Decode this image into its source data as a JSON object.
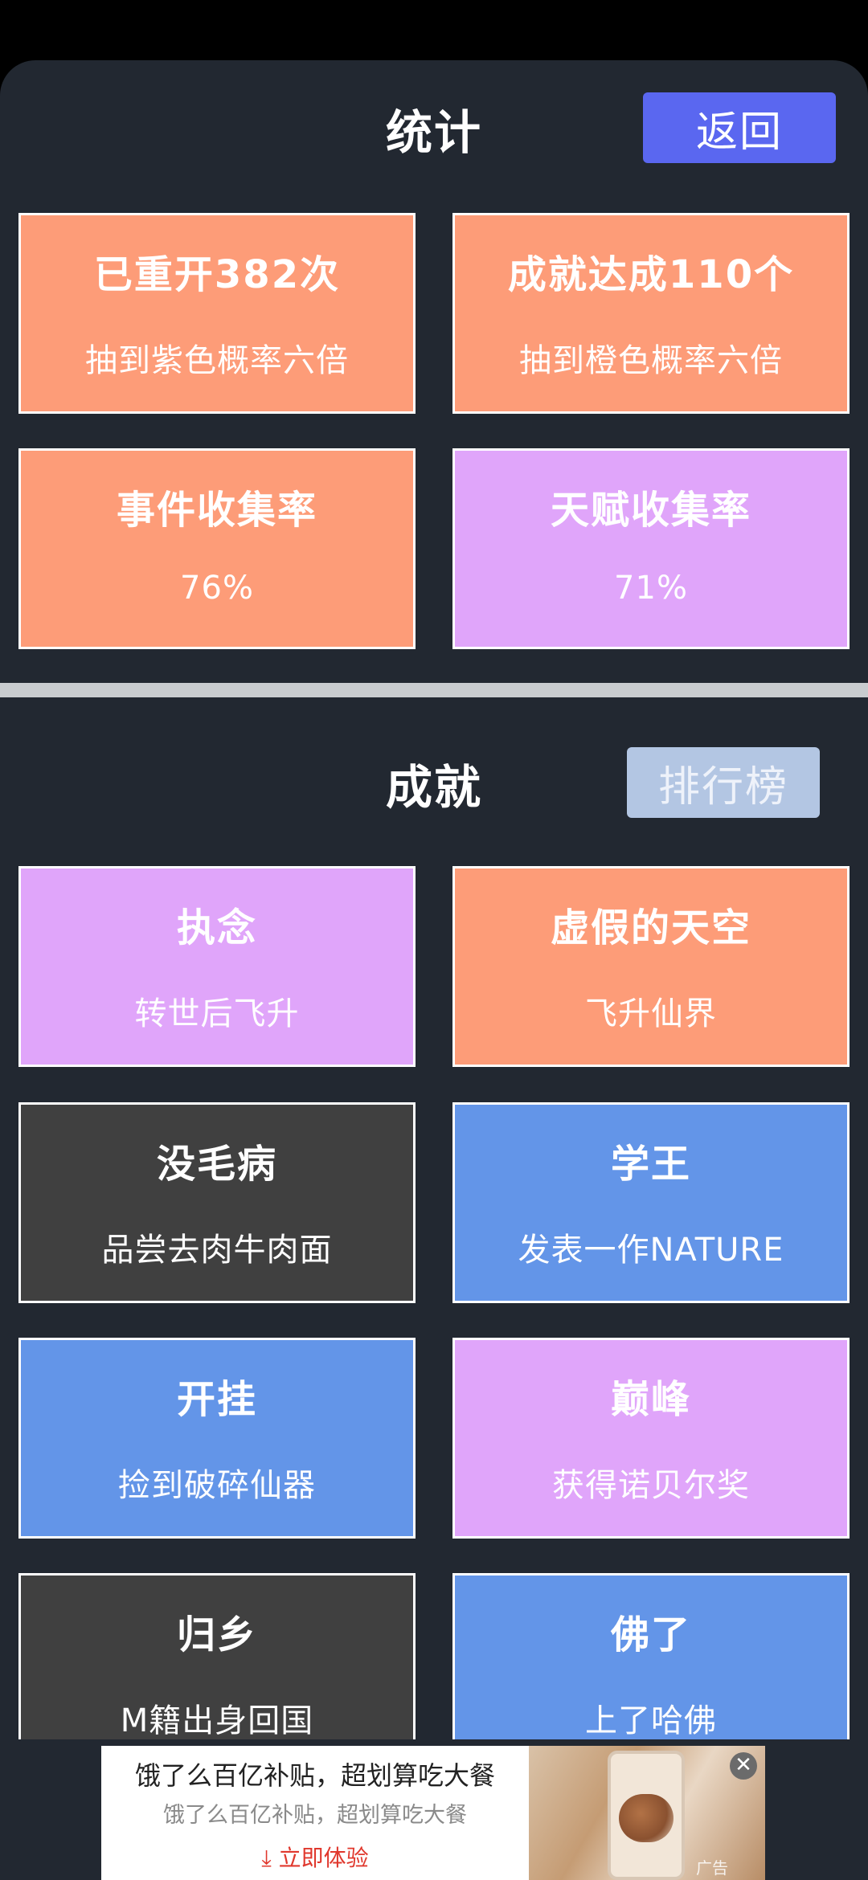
{
  "stats": {
    "title": "统计",
    "back_label": "返回",
    "cards": [
      {
        "title": "已重开382次",
        "sub": "抽到紫色概率六倍",
        "color": "#fd9c78"
      },
      {
        "title": "成就达成110个",
        "sub": "抽到橙色概率六倍",
        "color": "#fd9c78"
      },
      {
        "title": "事件收集率",
        "sub": "76%",
        "color": "#fd9c78"
      },
      {
        "title": "天赋收集率",
        "sub": "71%",
        "color": "#e0a5fa"
      }
    ]
  },
  "achievements": {
    "title": "成就",
    "rank_label": "排行榜",
    "cards": [
      {
        "title": "执念",
        "sub": "转世后飞升",
        "color": "#e0a5fa"
      },
      {
        "title": "虚假的天空",
        "sub": "飞升仙界",
        "color": "#fd9c78"
      },
      {
        "title": "没毛病",
        "sub": "品尝去肉牛肉面",
        "color": "#404040"
      },
      {
        "title": "学王",
        "sub": "发表一作NATURE",
        "color": "#6395e8"
      },
      {
        "title": "开挂",
        "sub": "捡到破碎仙器",
        "color": "#6395e8"
      },
      {
        "title": "巅峰",
        "sub": "获得诺贝尔奖",
        "color": "#e0a5fa"
      },
      {
        "title": "归乡",
        "sub": "M籍出身回国",
        "color": "#404040"
      },
      {
        "title": "佛了",
        "sub": "上了哈佛",
        "color": "#6395e8"
      }
    ]
  },
  "ad": {
    "title": "饿了么百亿补贴，超划算吃大餐",
    "desc": "饿了么百亿补贴，超划算吃大餐",
    "cta": "立即体验",
    "close_icon": "close-icon",
    "badge": "广告"
  }
}
